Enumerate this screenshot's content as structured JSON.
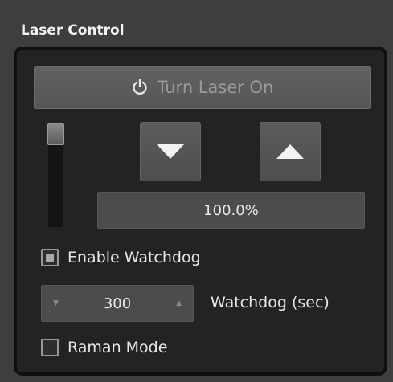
{
  "panel": {
    "title": "Laser Control"
  },
  "laser_button": {
    "label": "Turn Laser On",
    "icon": "power-icon"
  },
  "power": {
    "value_text": "100.0%",
    "slider_level": 1.0
  },
  "arrows": {
    "down_icon": "triangle-down-icon",
    "up_icon": "triangle-up-icon"
  },
  "watchdog": {
    "enable_label": "Enable Watchdog",
    "enabled": true,
    "seconds": "300",
    "seconds_label": "Watchdog (sec)"
  },
  "raman": {
    "label": "Raman Mode",
    "enabled": false
  },
  "colors": {
    "background": "#3e3e3e",
    "group": "#232323",
    "button": "#5c5c5c"
  }
}
